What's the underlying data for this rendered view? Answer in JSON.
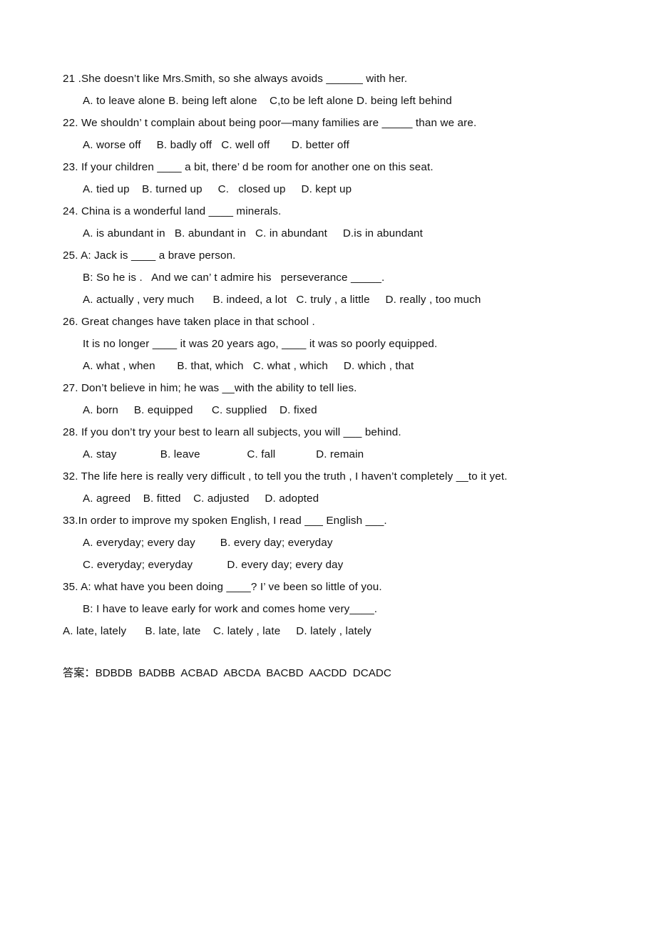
{
  "document": {
    "type": "worksheet",
    "language_mix": "English with Chinese answer label",
    "background_color": "#ffffff",
    "text_color": "#111111"
  },
  "questions": [
    {
      "number": "21",
      "stem": "21 .She doesn’t like Mrs.Smith, so she always avoids ______ with her.",
      "option_lines": [
        "A. to leave alone B. being left alone    C,to be left alone D. being left behind"
      ]
    },
    {
      "number": "22",
      "stem": "22. We shouldn’ t complain about being poor—many families are _____ than we are.",
      "option_lines": [
        "A. worse off     B. badly off   C. well off       D. better off"
      ]
    },
    {
      "number": "23",
      "stem": "23. If your children ____ a bit, there’ d be room for another one on this seat.",
      "option_lines": [
        "A. tied up    B. turned up     C.   closed up     D. kept up"
      ]
    },
    {
      "number": "24",
      "stem": "24. China is a wonderful land ____ minerals.",
      "option_lines": [
        "A. is abundant in   B. abundant in   C. in abundant     D.is in abundant"
      ]
    },
    {
      "number": "25",
      "stem": "25. A: Jack is ____ a brave person.",
      "extra_lines": [
        "B: So he is .   And we can’ t admire his   perseverance _____."
      ],
      "option_lines": [
        "A. actually , very much      B. indeed, a lot   C. truly , a little     D. really , too much"
      ]
    },
    {
      "number": "26",
      "stem": "26. Great changes have taken place in that school .",
      "extra_lines": [
        "It is no longer ____ it was 20 years ago, ____ it was so poorly equipped."
      ],
      "option_lines": [
        "A. what , when       B. that, which   C. what , which     D. which , that"
      ]
    },
    {
      "number": "27",
      "stem": "27. Don’t believe in him; he was __with the ability to tell lies.",
      "option_lines": [
        "A. born     B. equipped      C. supplied    D. fixed"
      ]
    },
    {
      "number": "28",
      "stem": "28. If you don’t try your best to learn all subjects, you will ___ behind.",
      "option_lines": [
        "A. stay              B. leave               C. fall             D. remain"
      ]
    },
    {
      "number": "32",
      "stem": "32. The life here is really very difficult , to tell you the truth , I haven’t completely __to it yet.",
      "option_lines": [
        "A. agreed    B. fitted    C. adjusted     D. adopted"
      ]
    },
    {
      "number": "33",
      "stem": "33.In order to improve my spoken English, I read ___ English ___.",
      "option_lines": [
        "A. everyday; every day        B. every day; everyday",
        "C. everyday; everyday           D. every day; every day"
      ]
    },
    {
      "number": "35",
      "stem": "35. A: what have you been doing ____? I’ ve been so little of you.",
      "extra_lines": [
        "B: I have to leave early for work and comes home very____."
      ],
      "flush_option_lines": [
        "A. late, lately      B. late, late    C. lately , late     D. lately , lately"
      ]
    }
  ],
  "answers": {
    "label": "答案：",
    "groups": [
      "BDBDB",
      "BADBB",
      "ACBAD",
      "ABCDA",
      "BACBD",
      "AACDD",
      "DCADC"
    ],
    "full_line": "答案：BDBDB  BADBB  ACBAD  ABCDA  BACBD  AACDD  DCADC"
  }
}
